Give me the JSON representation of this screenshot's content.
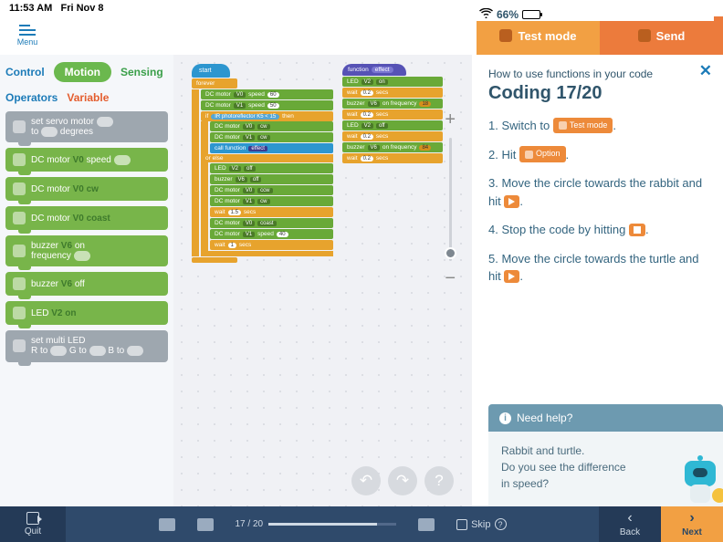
{
  "status": {
    "time": "11:53 AM",
    "date": "Fri Nov 8",
    "battery_pct": "66%"
  },
  "menu_label": "Menu",
  "top_buttons": {
    "test": "Test mode",
    "send": "Send"
  },
  "categories": {
    "control": "Control",
    "motion": "Motion",
    "sensing": "Sensing",
    "operators": "Operators",
    "variable": "Variable"
  },
  "palette": {
    "servo": "set servo motor",
    "servo2": "to",
    "servo3": "degrees",
    "dcspeed_a": "DC motor",
    "dcspeed_b": "speed",
    "v0": "V0",
    "dccw": "DC motor",
    "cw": "cw",
    "dccoast": "DC motor",
    "coast": "coast",
    "buzon_a": "buzzer",
    "buzon_b": "on",
    "v6": "V6",
    "buzon_c": "frequency",
    "buzoff_a": "buzzer",
    "buzoff_b": "off",
    "led_a": "LED",
    "v2": "V2",
    "on": "on",
    "multi": "set multi LED",
    "multir": "R to",
    "multig": "G to",
    "multib": "B to"
  },
  "canvas": {
    "start": "start",
    "forever": "forever",
    "dcm": "DC motor",
    "sp": "speed",
    "cw": "cw",
    "ccw": "ccw",
    "coast": "coast",
    "v0": "V0",
    "v1": "V1",
    "n60": "60",
    "n50": "50",
    "n40": "40",
    "if": "if",
    "then": "then",
    "ir": "IR photoreflector",
    "k5": "K5",
    "lt": "<",
    "c15": "15",
    "call": "call function",
    "eff": "effect",
    "else": "or else",
    "led": "LED",
    "v2": "V2",
    "off": "off",
    "on": "on",
    "buz": "buzzer",
    "onf": "on frequency",
    "n18": "18",
    "n84": "84",
    "wait": "wait",
    "s02": "0.2",
    "s15": "1.5",
    "s1": "1",
    "secs": "secs",
    "func": "function"
  },
  "help": {
    "sub": "How to use functions in your code",
    "title": "Coding 17/20",
    "close": "✕",
    "s1a": "1. Switch to ",
    "s1tag": "Test mode",
    "s1b": ".",
    "s2a": "2. Hit ",
    "s2tag": "Option",
    "s2b": ".",
    "s3": "3. Move the circle towards the rabbit and hit ",
    "s4": "4. Stop the code by hitting ",
    "s5": "5. Move the circle towards the turtle and hit ",
    "dot": ".",
    "need": "Need help?",
    "body1": "Rabbit and turtle.",
    "body2": "Do you see the difference",
    "body3": "in speed?"
  },
  "bottom": {
    "quit": "Quit",
    "progress": "17 / 20",
    "skip": "Skip",
    "back": "Back",
    "next": "Next"
  }
}
